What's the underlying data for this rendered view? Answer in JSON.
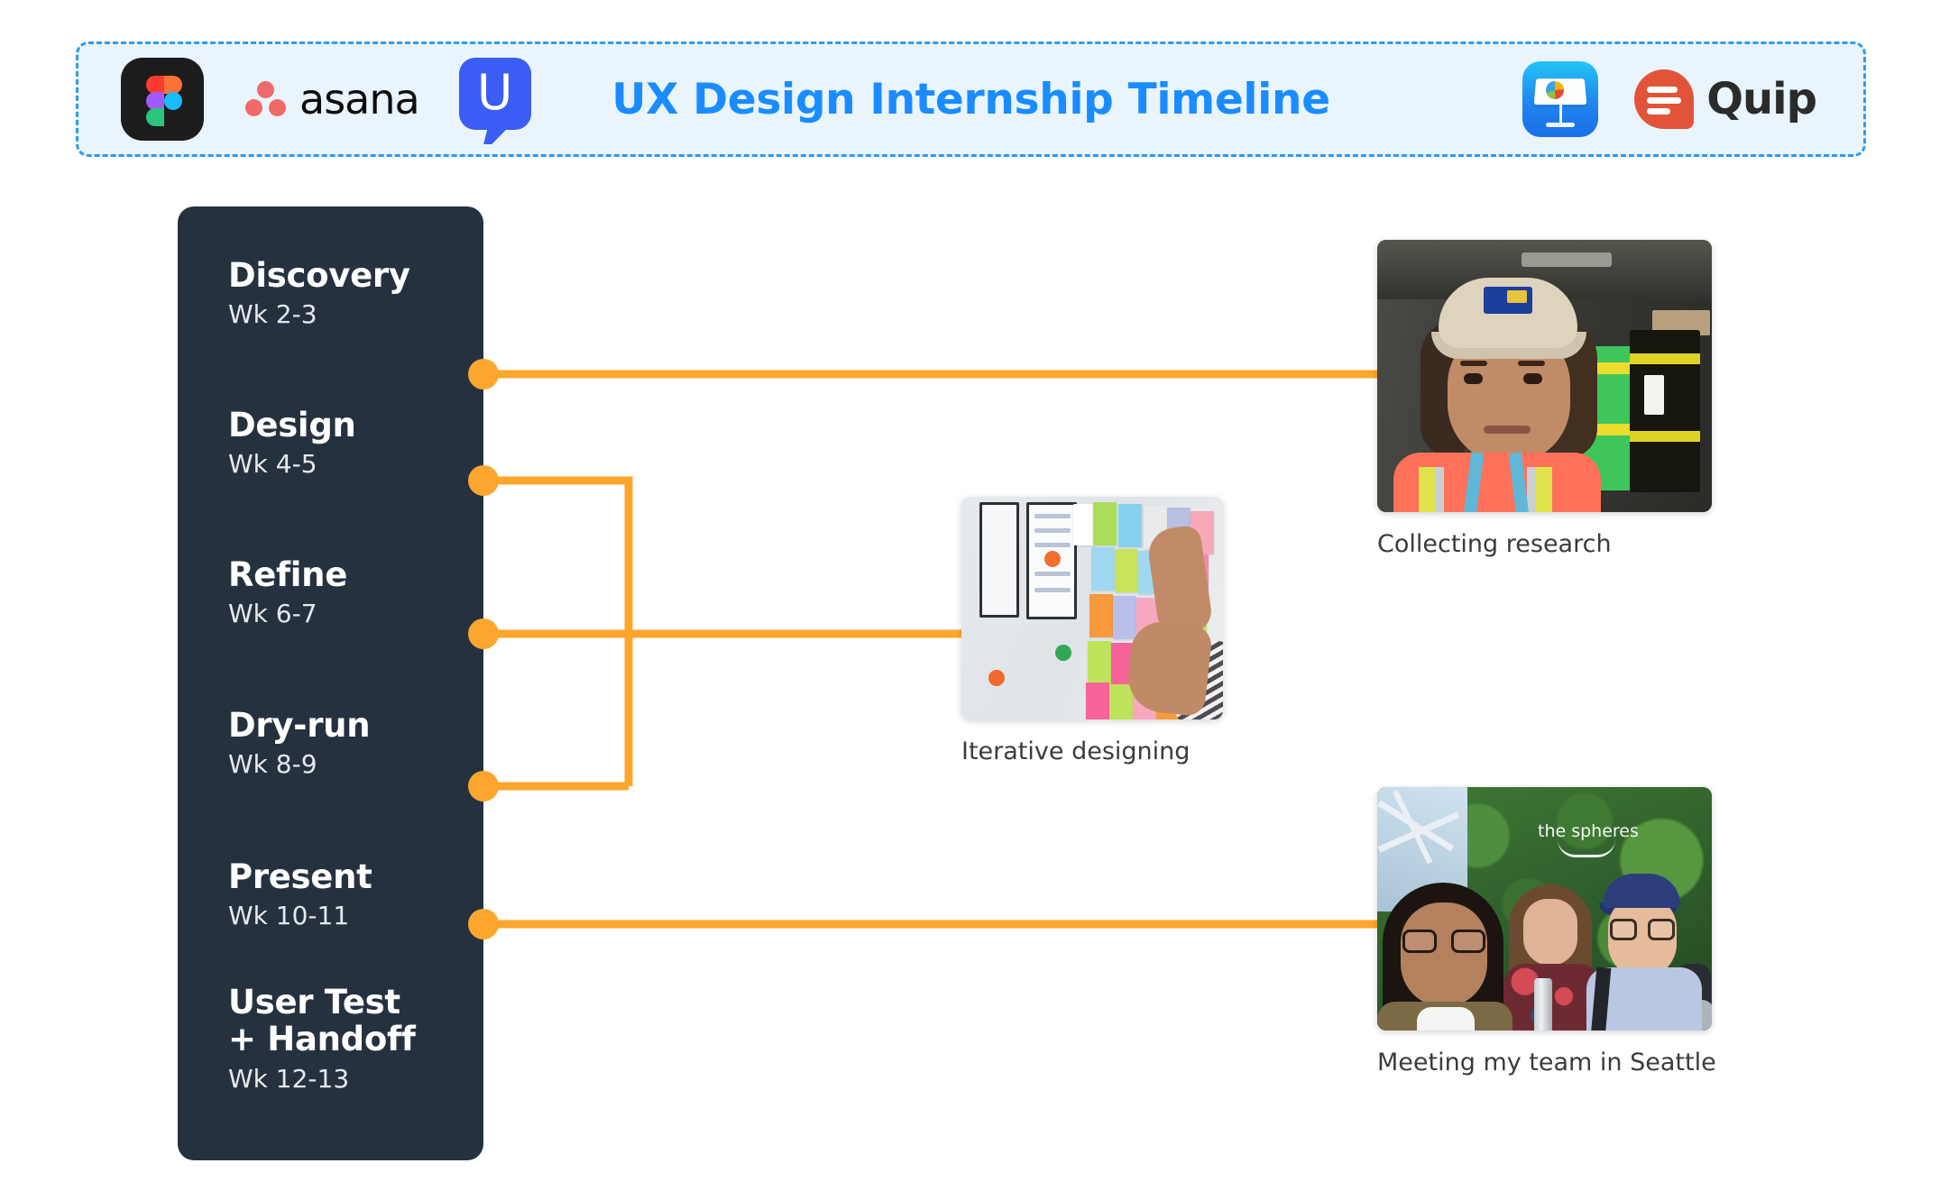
{
  "header": {
    "title": "UX Design Internship Timeline",
    "title_color": "#1a8cff",
    "background_color": "#e9f4fd",
    "border_color": "#2e9bf0",
    "logos_left": [
      {
        "name": "figma-logo",
        "label": "Figma"
      },
      {
        "name": "asana-logo",
        "label": "asana"
      },
      {
        "name": "usertesting-logo",
        "label": "U"
      }
    ],
    "logos_right": [
      {
        "name": "keynote-logo",
        "label": "Keynote"
      },
      {
        "name": "quip-logo",
        "label": "Quip"
      }
    ]
  },
  "sidebar": {
    "background_color": "#263140",
    "phases": [
      {
        "title": "Discovery",
        "weeks": "Wk 2-3"
      },
      {
        "title": "Design",
        "weeks": "Wk 4-5"
      },
      {
        "title": "Refine",
        "weeks": "Wk 6-7"
      },
      {
        "title": "Dry-run",
        "weeks": "Wk 8-9"
      },
      {
        "title": "Present",
        "weeks": "Wk 10-11"
      },
      {
        "title": "User Test\n+ Handoff",
        "weeks": "Wk 12-13"
      }
    ]
  },
  "timeline": {
    "connector_color": "#fca62e",
    "nodes": [
      {
        "phase": "Discovery",
        "has_connector": false
      },
      {
        "phase": "Design",
        "has_connector": true,
        "target": "Iterative designing"
      },
      {
        "phase": "Refine",
        "has_connector": true,
        "target": "Iterative designing"
      },
      {
        "phase": "Dry-run",
        "has_connector": true,
        "target": "Iterative designing"
      },
      {
        "phase": "Present",
        "has_connector": true,
        "target": "Meeting my team in Seattle"
      }
    ],
    "research_connector": {
      "from": "between Discovery and Design",
      "target": "Collecting research"
    }
  },
  "photos": [
    {
      "id": "collecting-research",
      "caption": "Collecting research",
      "alt": "Intern wearing a cap and high-visibility safety vest inside a delivery truck"
    },
    {
      "id": "iterative-designing",
      "caption": "Iterative designing",
      "alt": "Hands placing colorful sticky notes on a whiteboard"
    },
    {
      "id": "meeting-team-seattle",
      "caption": "Meeting my team in Seattle",
      "alt": "Three colleagues smiling in front of the green plant wall at the Spheres"
    }
  ]
}
